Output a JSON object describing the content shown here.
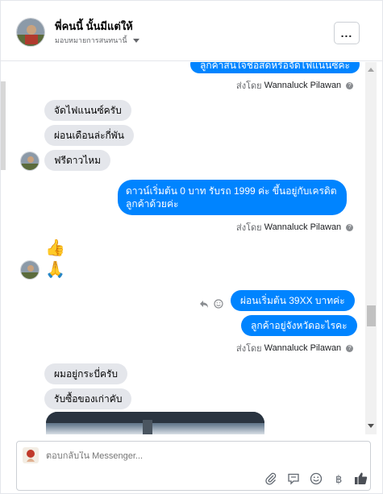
{
  "header": {
    "contact_name": "พี่คนนี้ นั้นมีแต่ให้",
    "assign_label": "มอบหมายการสนทนานี้",
    "more_label": "..."
  },
  "messages": {
    "out_top": "ลูกค้าสนใจชื่อสดหรือจัดไฟแนนซ์คะ",
    "sent_by_1_prefix": "ส่งโดย",
    "sent_by_1_name": "Wannaluck Pilawan",
    "in_1": "จัดไฟแนนซ์ครับ",
    "in_2": "ผ่อนเดือนล่ะกี่พัน",
    "in_3": "ฟรีดาวไหม",
    "out_2_line1": "ดาวน์เริ่มต้น 0 บาท รับรถ 1999 ค่ะ  ขึ้นอยู่กับเครดิต",
    "out_2_line2": "ลูกค้าด้วยค่ะ",
    "sent_by_2_prefix": "ส่งโดย",
    "sent_by_2_name": "Wannaluck Pilawan",
    "emoji_1": "👍",
    "emoji_2": "🙏",
    "out_3": "ผ่อนเริ่มต้น 39XX  บาทค่ะ",
    "out_4": "ลูกค้าอยู่จังหวัดอะไรคะ",
    "sent_by_3_prefix": "ส่งโดย",
    "sent_by_3_name": "Wannaluck Pilawan",
    "in_4": "ผมอยู่กระบี่ครับ",
    "in_5": "รับซื้อของเก่าคับ"
  },
  "composer": {
    "placeholder": "ตอบกลับใน Messenger..."
  },
  "colors": {
    "outgoing": "#0084ff",
    "incoming": "#e4e6eb"
  },
  "icons": [
    "more-icon",
    "caret-down-icon",
    "question-icon",
    "reply-icon",
    "smiley-icon",
    "attachment-icon",
    "saved-reply-icon",
    "emoji-icon",
    "baht-icon",
    "thumbs-up-icon"
  ]
}
